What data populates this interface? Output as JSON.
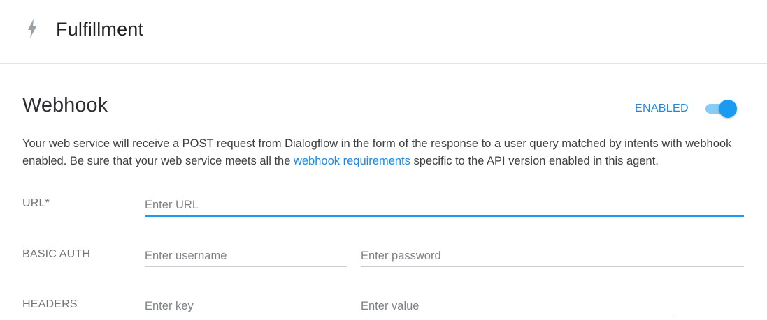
{
  "header": {
    "title": "Fulfillment",
    "icon": "bolt-icon"
  },
  "webhook": {
    "title": "Webhook",
    "status_label": "ENABLED",
    "toggle_on": true,
    "description_before": "Your web service will receive a POST request from Dialogflow in the form of the response to a user query matched by intents with webhook enabled. Be sure that your web service meets all the ",
    "description_link": "webhook requirements",
    "description_after": " specific to the API version enabled in this agent."
  },
  "form": {
    "url": {
      "label": "URL*",
      "placeholder": "Enter URL",
      "value": ""
    },
    "basic_auth": {
      "label": "BASIC AUTH",
      "username_placeholder": "Enter username",
      "password_placeholder": "Enter password"
    },
    "headers": {
      "label": "HEADERS",
      "key_placeholder": "Enter key",
      "value_placeholder": "Enter value"
    }
  },
  "colors": {
    "accent": "#1a9af1",
    "link": "#1e88e5",
    "toggle_track": "#85cdf7",
    "label_gray": "#70757a"
  }
}
